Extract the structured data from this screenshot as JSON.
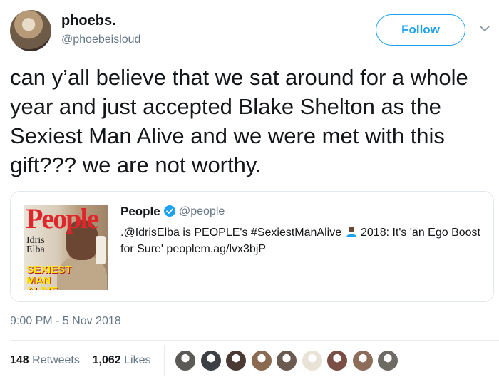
{
  "author": {
    "name": "phoebs.",
    "handle": "@phoebeisloud"
  },
  "follow_label": "Follow",
  "tweet_text": "can y’all believe that we sat around for a whole year and just accepted Blake Shelton as the Sexiest Man Alive and we were met with this gift??? we are not worthy.",
  "quoted": {
    "name": "People",
    "handle": "@people",
    "text_before": ".@IdrisElba is PEOPLE's #SexiestManAlive",
    "text_after": " 2018: It's 'an Ego Boost for Sure' peoplem.ag/lvx3bjP",
    "cover": {
      "masthead": "People",
      "person": "Idris\nElba",
      "headline": "SEXIEST\nMAN\nALIVE"
    }
  },
  "timestamp": "9:00 PM - 5 Nov 2018",
  "stats": {
    "retweets_count": "148",
    "retweets_label": "Retweets",
    "likes_count": "1,062",
    "likes_label": "Likes"
  },
  "likers": [
    "#5c5a57",
    "#3c3f44",
    "#4a3a33",
    "#8a6b52",
    "#6a5a4f",
    "#e9e2d6",
    "#7a4e44",
    "#8d6d5a",
    "#6e6a64"
  ],
  "colors": {
    "accent": "#1da1f2",
    "muted": "#657786",
    "text": "#14171a",
    "border": "#e1e8ed"
  }
}
